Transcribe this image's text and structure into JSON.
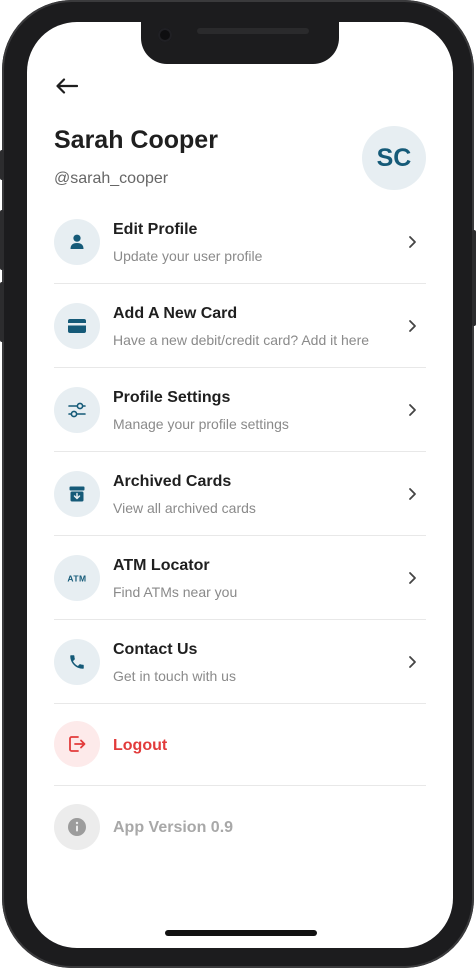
{
  "profile": {
    "name": "Sarah Cooper",
    "handle": "@sarah_cooper",
    "initials": "SC"
  },
  "menu": {
    "items": [
      {
        "title": "Edit Profile",
        "subtitle": "Update your user profile",
        "icon": "person-icon"
      },
      {
        "title": "Add A New Card",
        "subtitle": "Have a new debit/credit card? Add it here",
        "icon": "card-icon"
      },
      {
        "title": "Profile Settings",
        "subtitle": "Manage your profile settings",
        "icon": "sliders-icon"
      },
      {
        "title": "Archived Cards",
        "subtitle": "View all archived cards",
        "icon": "archive-icon"
      },
      {
        "title": "ATM Locator",
        "subtitle": "Find ATMs near you",
        "icon": "atm-icon"
      },
      {
        "title": "Contact Us",
        "subtitle": "Get in touch with us",
        "icon": "phone-icon"
      }
    ],
    "logout": "Logout",
    "version": "App Version 0.9"
  },
  "icons": {
    "atm_text": "ATM"
  },
  "colors": {
    "accent": "#155a78",
    "icon_bg": "#e7eef2",
    "logout": "#e23b3b",
    "logout_bg": "#fdeaea",
    "muted": "#a8a8a8"
  }
}
